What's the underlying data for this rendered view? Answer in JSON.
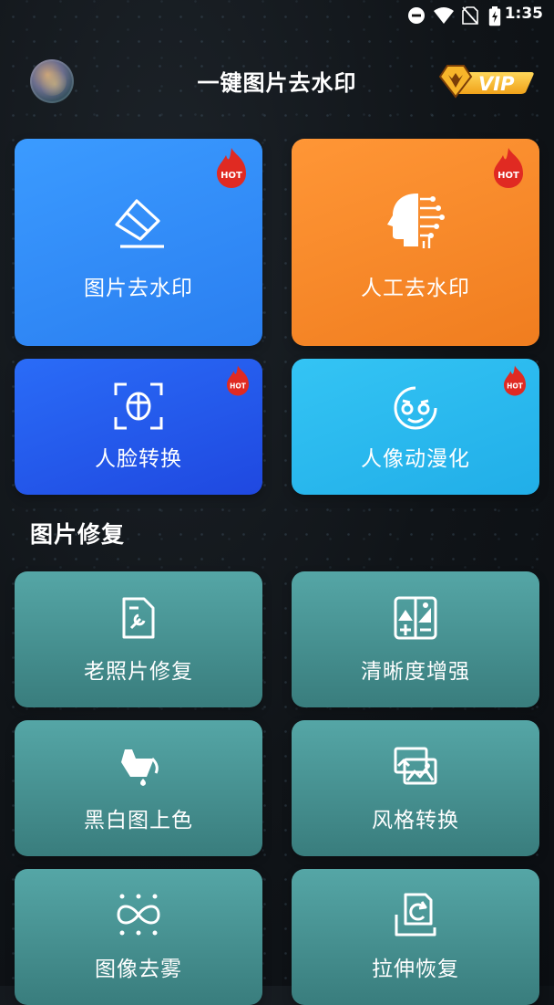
{
  "status_bar": {
    "time": "1:35",
    "icons": [
      "do-not-disturb-icon",
      "wifi-icon",
      "no-sim-icon",
      "battery-charging-icon"
    ]
  },
  "header": {
    "title": "一键图片去水印",
    "avatar_icon": "avatar",
    "vip_label": "VIP"
  },
  "featured": [
    {
      "label": "图片去水印",
      "icon": "eraser-icon",
      "badge": "HOT",
      "color": "#3b9bff"
    },
    {
      "label": "人工去水印",
      "icon": "ai-head-icon",
      "badge": "HOT",
      "color": "#ff9636"
    },
    {
      "label": "人脸转换",
      "icon": "face-scan-icon",
      "badge": "HOT",
      "color": "#2a6cf7"
    },
    {
      "label": "人像动漫化",
      "icon": "anime-face-icon",
      "badge": "HOT",
      "color": "#34c4f4"
    }
  ],
  "repair_section": {
    "title": "图片修复",
    "items": [
      {
        "label": "老照片修复",
        "icon": "photo-repair-icon"
      },
      {
        "label": "清晰度增强",
        "icon": "contrast-enhance-icon"
      },
      {
        "label": "黑白图上色",
        "icon": "paint-bucket-icon"
      },
      {
        "label": "风格转换",
        "icon": "style-transfer-icon"
      },
      {
        "label": "图像去雾",
        "icon": "dehaze-icon"
      },
      {
        "label": "拉伸恢复",
        "icon": "stretch-restore-icon"
      }
    ]
  },
  "colors": {
    "hot_badge": "#e02a22",
    "vip_gold": "#f5b31f",
    "repair_card": "#4c9b9b"
  }
}
